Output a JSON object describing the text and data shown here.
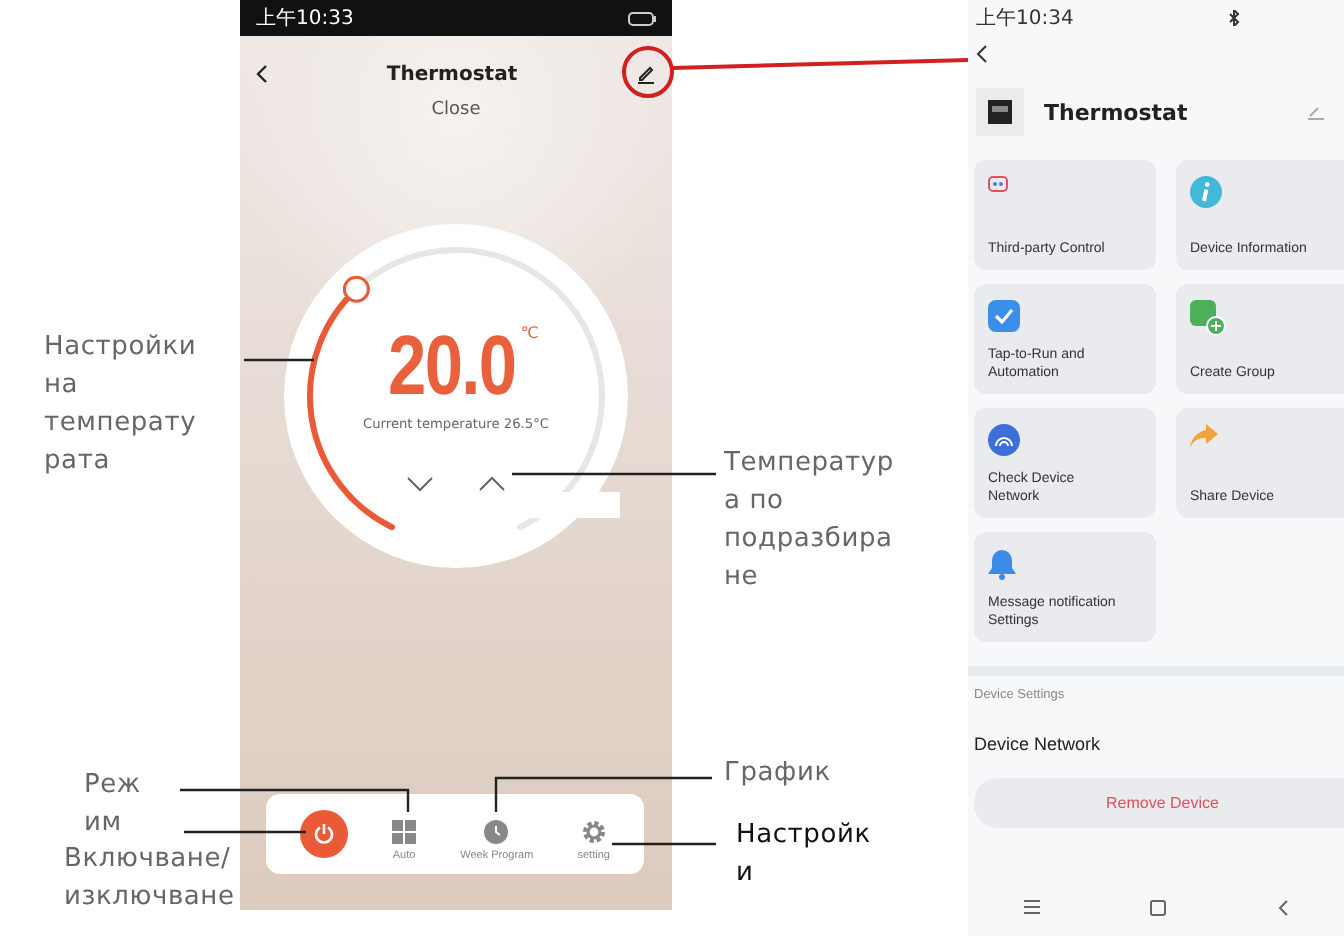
{
  "left_phone": {
    "status_time": "上午10:33",
    "title": "Thermostat",
    "subtitle": "Close",
    "setpoint": "20.0",
    "unit": "℃",
    "current_temperature": "Current temperature 26.5°C",
    "controls": [
      {
        "label": "Auto"
      },
      {
        "label": "Week Program"
      },
      {
        "label": "setting"
      }
    ]
  },
  "annotations": [
    {
      "text": "Настройки\nна\nтемперату\nрата"
    },
    {
      "text": "Температур\nа по\nподразбира\nне"
    },
    {
      "text": "Реж\nим"
    },
    {
      "text": "Включване/\nизключване"
    },
    {
      "text": "График"
    },
    {
      "text": "Настройк\nи"
    }
  ],
  "right_phone": {
    "status_time": "上午10:34",
    "title": "Thermostat",
    "tiles": [
      {
        "label": "Third-party Control"
      },
      {
        "label": "Device Information"
      },
      {
        "label": "Tap-to-Run and\nAutomation"
      },
      {
        "label": "Create Group"
      },
      {
        "label": "Check Device\nNetwork"
      },
      {
        "label": "Share Device"
      },
      {
        "label": "Message notification\nSettings"
      }
    ],
    "section": "Device Settings",
    "row": "Device Network",
    "button": "Remove Device"
  }
}
